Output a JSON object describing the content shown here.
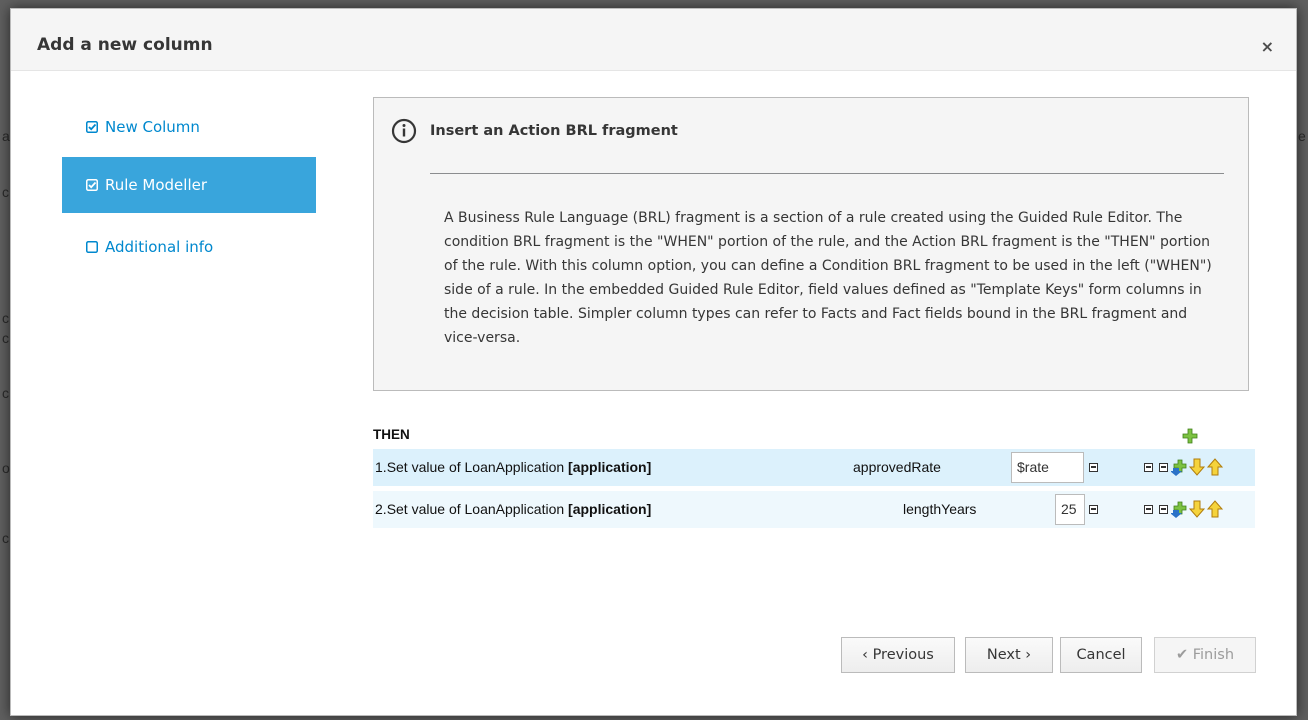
{
  "dialog": {
    "title": "Add a new column",
    "close": "×"
  },
  "steps": [
    {
      "label": "New Column",
      "checked": true,
      "active": false
    },
    {
      "label": "Rule Modeller",
      "checked": true,
      "active": true
    },
    {
      "label": "Additional info",
      "checked": false,
      "active": false
    }
  ],
  "info": {
    "title": "Insert an Action BRL fragment",
    "body": "A Business Rule Language (BRL) fragment is a section of a rule created using the Guided Rule Editor. The condition BRL fragment is the \"WHEN\" portion of the rule, and the Action BRL fragment is the \"THEN\" portion of the rule. With this column option, you can define a Condition BRL fragment to be used in the left (\"WHEN\") side of a rule. In the embedded Guided Rule Editor, field values defined as \"Template Keys\" form columns in the decision table. Simpler column types can refer to Facts and Fact fields bound in the BRL fragment and vice-versa."
  },
  "rule": {
    "section": "THEN",
    "actions": [
      {
        "num": "1.",
        "text": "Set value of LoanApplication ",
        "binding": "[application]",
        "field": "approvedRate",
        "value": "$rate"
      },
      {
        "num": "2.",
        "text": "Set value of LoanApplication ",
        "binding": "[application]",
        "field": "lengthYears",
        "value": "25"
      }
    ]
  },
  "buttons": {
    "previous": "‹ Previous",
    "next": "Next ›",
    "cancel": "Cancel",
    "finish": "✔ Finish"
  },
  "colors": {
    "accent": "#39a5dc",
    "link": "#0088ce",
    "row1": "#dcf1fc",
    "row2": "#eef8fd"
  },
  "icons": [
    "check-square-icon",
    "square-icon",
    "info-circle-icon",
    "add-icon",
    "remove-icon",
    "move-down-icon",
    "move-up-icon",
    "add-below-icon"
  ]
}
